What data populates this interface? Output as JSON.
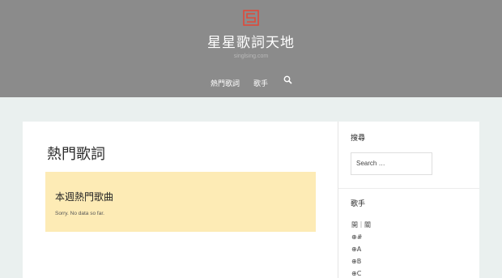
{
  "header": {
    "site_title": "星星歌詞天地",
    "site_subtitle": "singlsing.com",
    "nav": [
      {
        "label": "熱門歌詞"
      },
      {
        "label": "歌手"
      }
    ],
    "logo_icon": "logo-icon",
    "search_icon": "search-icon",
    "logo_color": "#e04a3a"
  },
  "main": {
    "page_title": "熱門歌詞",
    "notice": {
      "title": "本週熱門歌曲",
      "text": "Sorry. No data so far."
    }
  },
  "sidebar": {
    "search_title": "搜尋",
    "search_placeholder": "Search …",
    "singer_title": "歌手",
    "singer_links": [
      "開｜關",
      "⊕#",
      "⊕A",
      "⊕B",
      "⊕C"
    ]
  }
}
